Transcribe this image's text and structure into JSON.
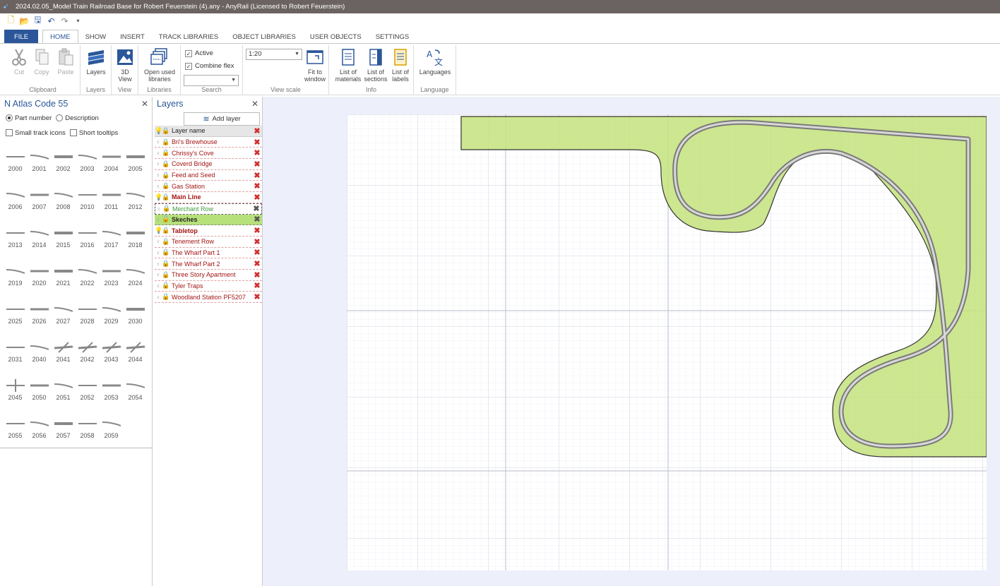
{
  "window": {
    "title": "2024.02.05_Model Train Railroad Base for Robert Feuerstein (4).any - AnyRail (Licensed to Robert Feuerstein)"
  },
  "quick_access": {
    "icons": [
      "new-icon",
      "open-icon",
      "save-icon",
      "undo-icon",
      "redo-icon",
      "customize-icon"
    ]
  },
  "menu_tabs": [
    "FILE",
    "HOME",
    "SHOW",
    "INSERT",
    "TRACK LIBRARIES",
    "OBJECT LIBRARIES",
    "USER OBJECTS",
    "SETTINGS"
  ],
  "ribbon": {
    "clipboard": {
      "cut": "Cut",
      "copy": "Copy",
      "paste": "Paste",
      "group": "Clipboard"
    },
    "layers": {
      "button": "Layers",
      "group": "Layers"
    },
    "view": {
      "button_line1": "3D",
      "button_line2": "View",
      "group": "View"
    },
    "libraries": {
      "button_line1": "Open used",
      "button_line2": "libraries",
      "group": "Libraries"
    },
    "search": {
      "active": "Active",
      "combine_flex": "Combine flex",
      "group": "Search"
    },
    "view_scale": {
      "scale": "1:20",
      "fit_line1": "Fit to",
      "fit_line2": "window",
      "group": "View scale"
    },
    "info": {
      "materials_line1": "List of",
      "materials_line2": "materials",
      "sections_line1": "List of",
      "sections_line2": "sections",
      "labels_line1": "List of",
      "labels_line2": "labels",
      "group": "Info"
    },
    "language": {
      "button": "Languages",
      "group": "Language"
    }
  },
  "library_panel": {
    "title": "N Atlas Code 55",
    "radio_part": "Part number",
    "radio_desc": "Description",
    "small_icons": "Small track icons",
    "short_tooltips": "Short tooltips",
    "parts": [
      [
        "2000",
        "2001",
        "2002",
        "2003",
        "2004",
        "2005"
      ],
      [
        "2006",
        "2007",
        "2008",
        "2010",
        "2011",
        "2012"
      ],
      [
        "2013",
        "2014",
        "2015",
        "2016",
        "2017",
        "2018"
      ],
      [
        "2019",
        "2020",
        "2021",
        "2022",
        "2023",
        "2024"
      ],
      [
        "2025",
        "2026",
        "2027",
        "2028",
        "2029",
        "2030"
      ],
      [
        "2031",
        "2040",
        "2041",
        "2042",
        "2043",
        "2044"
      ],
      [
        "2045",
        "2050",
        "2051",
        "2052",
        "2053",
        "2054"
      ],
      [
        "2055",
        "2056",
        "2057",
        "2058",
        "2059"
      ]
    ]
  },
  "layers_panel": {
    "title": "Layers",
    "add_layer": "Add layer",
    "header": "Layer name",
    "layers": [
      "Bri's Brewhouse",
      "Chrissy's Cove",
      "Coverd Bridge",
      "Feed and Seed",
      "Gas Station",
      "Main Line",
      "Merchant Row",
      "Skeches",
      "Tabletop",
      "Tenement Row",
      "The Wharf Part 1",
      "The Wharf Part 2",
      "Three Story Apartment",
      "Tyler Traps",
      "Woodland Station PF5207"
    ]
  },
  "colors": {
    "accent": "#2b579a",
    "layout_fill": "#c4e27d",
    "layer_text": "#a31515",
    "selected_layer": "#b6e07a"
  }
}
